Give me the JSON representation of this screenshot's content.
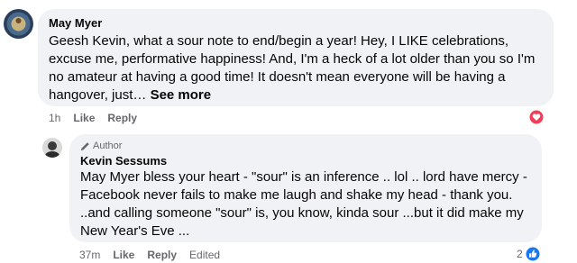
{
  "comment": {
    "author": "May Myer",
    "text": "Geesh Kevin, what a sour note to end/begin a year! Hey, I LIKE celebrations, excuse me, performative happiness! And, I'm a heck of a lot older than you so I'm no amateur at having a good time! It doesn't mean everyone will be having a hangover, just… ",
    "see_more": "See more",
    "time": "1h",
    "like": "Like",
    "reply": "Reply",
    "reaction_icon": "heart-icon"
  },
  "reply": {
    "badge": "Author",
    "author": "Kevin Sessums",
    "text": "May Myer bless your heart - \"sour\" is an inference .. lol .. lord have mercy - Facebook never fails to make me laugh and shake my head - thank you. ..and calling someone \"sour\" is, you know, kinda sour ...but it did make my New Year's Eve ...",
    "time": "37m",
    "like": "Like",
    "reply": "Reply",
    "edited": "Edited",
    "reaction_count": "2",
    "reaction_icon": "thumbs-up-icon"
  },
  "colors": {
    "bubble": "#f0f2f5",
    "secondary_text": "#65676b",
    "like_blue": "#1877f2",
    "love_red": "#f33e58"
  }
}
